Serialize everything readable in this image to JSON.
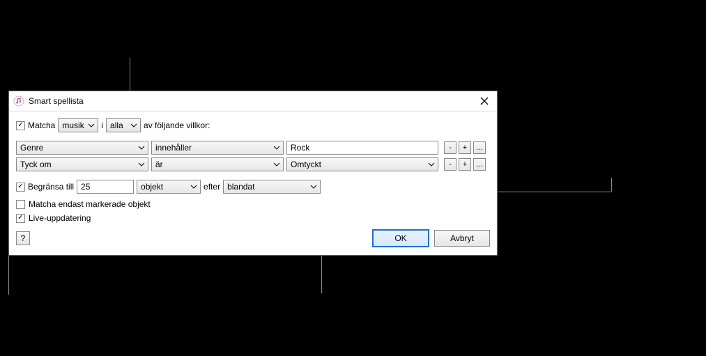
{
  "dialog": {
    "title": "Smart spellista",
    "match": {
      "checkbox_label": "Matcha",
      "checked": true,
      "source": "musik",
      "connector": "i",
      "scope": "alla",
      "suffix": "av följande villkor:"
    },
    "rules": [
      {
        "field": "Genre",
        "operator": "innehåller",
        "value_type": "text",
        "value": "Rock"
      },
      {
        "field": "Tyck om",
        "operator": "är",
        "value_type": "select",
        "value": "Omtyckt"
      }
    ],
    "rule_buttons": {
      "remove": "-",
      "add": "+",
      "nest": "…"
    },
    "limit": {
      "checkbox_label": "Begränsa till",
      "checked": true,
      "amount": "25",
      "unit": "objekt",
      "after_label": "efter",
      "order": "blandat"
    },
    "only_checked": {
      "label": "Matcha endast markerade objekt",
      "checked": false
    },
    "live_update": {
      "label": "Live-uppdatering",
      "checked": true
    },
    "buttons": {
      "help": "?",
      "ok": "OK",
      "cancel": "Avbryt"
    }
  }
}
